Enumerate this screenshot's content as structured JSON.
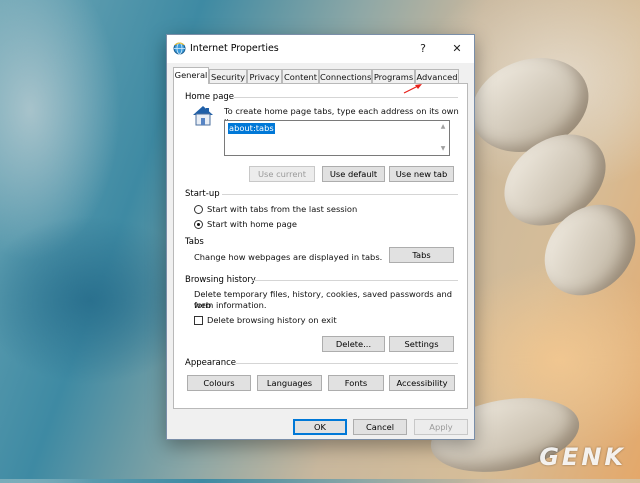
{
  "dialog": {
    "title": "Internet Properties",
    "help_label": "?",
    "close_label": "✕"
  },
  "tabs": [
    {
      "label": "General",
      "active": true
    },
    {
      "label": "Security"
    },
    {
      "label": "Privacy"
    },
    {
      "label": "Content"
    },
    {
      "label": "Connections"
    },
    {
      "label": "Programs"
    },
    {
      "label": "Advanced"
    }
  ],
  "home_page": {
    "heading": "Home page",
    "description": "To create home page tabs, type each address on its own line.",
    "value": "about:tabs",
    "buttons": {
      "use_current": "Use current",
      "use_default": "Use default",
      "use_new_tab": "Use new tab"
    }
  },
  "startup": {
    "heading": "Start-up",
    "options": [
      {
        "label": "Start with tabs from the last session",
        "checked": false
      },
      {
        "label": "Start with home page",
        "checked": true
      }
    ]
  },
  "tabs_section": {
    "heading": "Tabs",
    "description": "Change how webpages are displayed in tabs.",
    "button": "Tabs"
  },
  "browsing_history": {
    "heading": "Browsing history",
    "description_line1": "Delete temporary files, history, cookies, saved passwords and web",
    "description_line2": "form information.",
    "checkbox_label": "Delete browsing history on exit",
    "checkbox_checked": false,
    "delete_button": "Delete...",
    "settings_button": "Settings"
  },
  "appearance": {
    "heading": "Appearance",
    "buttons": {
      "colours": "Colours",
      "languages": "Languages",
      "fonts": "Fonts",
      "accessibility": "Accessibility"
    }
  },
  "footer": {
    "ok": "OK",
    "cancel": "Cancel",
    "apply": "Apply"
  },
  "watermark": "GENK",
  "colors": {
    "accent": "#0078d7",
    "arrow": "#e8221b"
  },
  "icons": {
    "app": "internet-explorer-globe-icon",
    "home": "home-icon"
  }
}
